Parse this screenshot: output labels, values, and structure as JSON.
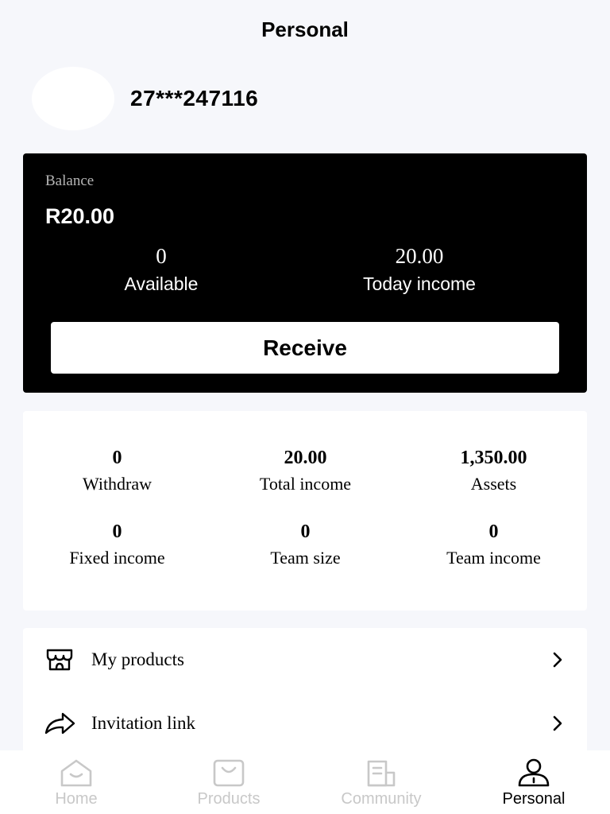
{
  "header": {
    "title": "Personal"
  },
  "profile": {
    "user_id": "27***247116"
  },
  "balance": {
    "label": "Balance",
    "amount": "R20.00",
    "available_value": "0",
    "available_label": "Available",
    "today_income_value": "20.00",
    "today_income_label": "Today income",
    "receive_label": "Receive"
  },
  "stats": [
    {
      "value": "0",
      "label": "Withdraw"
    },
    {
      "value": "20.00",
      "label": "Total income"
    },
    {
      "value": "1,350.00",
      "label": "Assets"
    },
    {
      "value": "0",
      "label": "Fixed income"
    },
    {
      "value": "0",
      "label": "Team size"
    },
    {
      "value": "0",
      "label": "Team income"
    }
  ],
  "menu": [
    {
      "label": "My products",
      "icon": "store-icon"
    },
    {
      "label": "Invitation link",
      "icon": "share-icon"
    }
  ],
  "tabbar": [
    {
      "label": "Home",
      "icon": "home-icon",
      "active": false
    },
    {
      "label": "Products",
      "icon": "bag-icon",
      "active": false
    },
    {
      "label": "Community",
      "icon": "community-icon",
      "active": false
    },
    {
      "label": "Personal",
      "icon": "user-icon",
      "active": true
    }
  ],
  "colors": {
    "background": "#f6f7fb",
    "card": "#000000",
    "inactive_tab": "#c8c8c8"
  }
}
